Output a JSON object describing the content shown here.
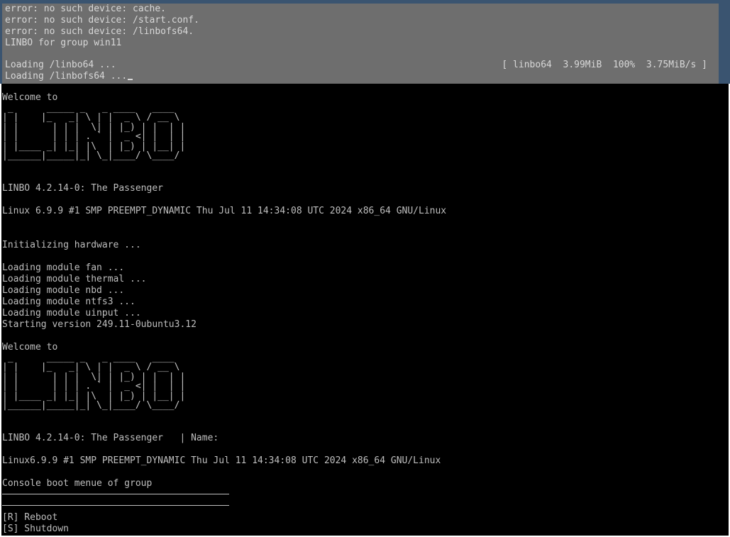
{
  "grub": {
    "lines": [
      "error: no such device: cache.",
      "error: no such device: /start.conf.",
      "error: no such device: /linbofs64.",
      "LINBO for group win11",
      "",
      "Loading /linbo64 ...",
      "Loading /linbofs64 ..."
    ],
    "status": "[ linbo64  3.99MiB  100%  3.75MiB/s ]"
  },
  "console": {
    "welcome1": "Welcome to",
    "logo_art": " _      _____ _   _ ____   ____  \n| |    |_   _| \\ | |  _ \\ / __ \\ \n| |      | | |  \\| | |_) | |  | |\n| |      | | | . ` |  _ <| |  | |\n| |____ _| |_| |\\  | |_) | |__| |\n|______|_____|_| \\_|____/ \\____/ ",
    "version1": "LINBO 4.2.14-0: The Passenger",
    "kernel1": "Linux 6.9.9 #1 SMP PREEMPT_DYNAMIC Thu Jul 11 14:34:08 UTC 2024 x86_64 GNU/Linux",
    "init": "Initializing hardware ...",
    "modules": [
      "Loading module fan ...",
      "Loading module thermal ...",
      "Loading module nbd ...",
      "Loading module ntfs3 ...",
      "Loading module uinput ..."
    ],
    "starting": "Starting version 249.11-0ubuntu3.12",
    "welcome2": "Welcome to",
    "version2": "LINBO 4.2.14-0: The Passenger   | Name:",
    "kernel2": "Linux6.9.9 #1 SMP PREEMPT_DYNAMIC Thu Jul 11 14:34:08 UTC 2024 x86_64 GNU/Linux",
    "menu_title": "Console boot menue of group",
    "options": [
      "[R] Reboot",
      "[S] Shutdown"
    ]
  },
  "colors": {
    "grub_frame": "#3a5470",
    "grub_panel": "#6e6e6e",
    "console_bg": "#000000",
    "console_text": "#bfbfbf"
  }
}
